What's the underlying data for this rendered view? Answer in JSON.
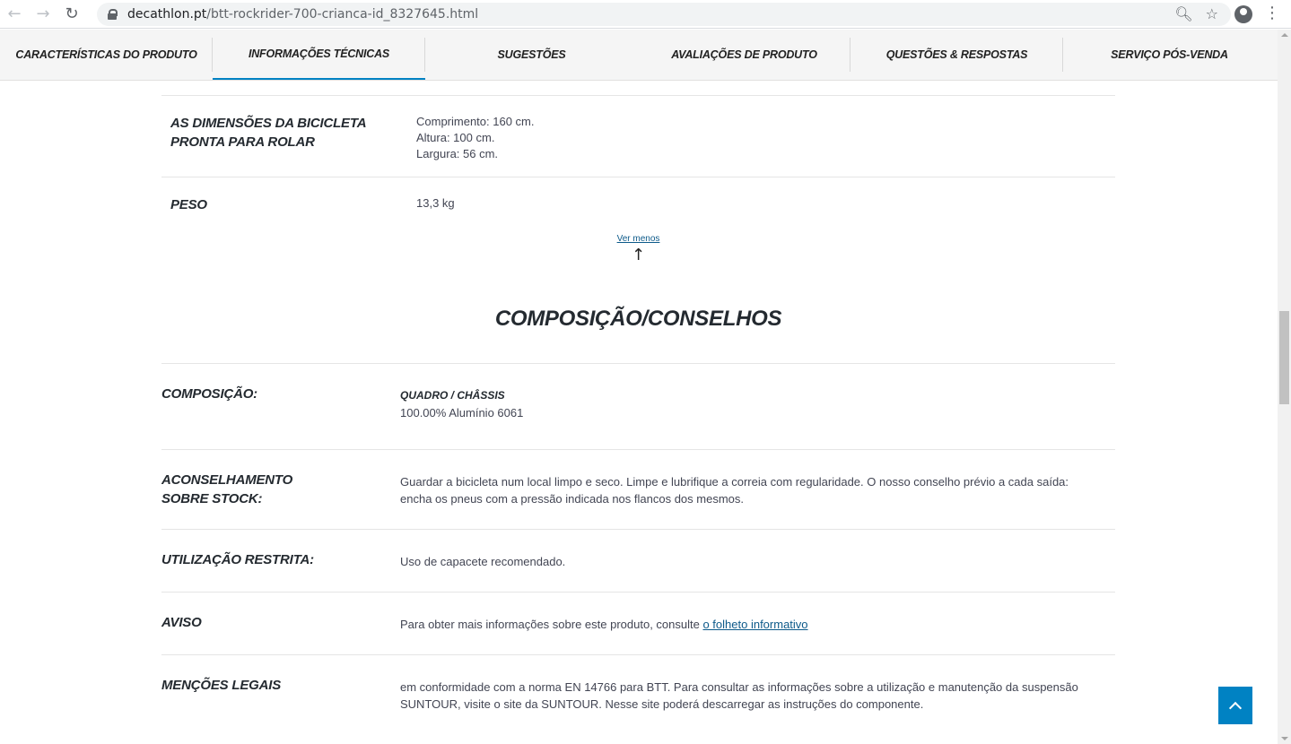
{
  "browser": {
    "url_domain": "decathlon.pt",
    "url_path": "/btt-rockrider-700-crianca-id_8327645.html"
  },
  "tabs": [
    {
      "label": "CARACTERÍSTICAS DO PRODUTO"
    },
    {
      "label": "INFORMAÇÕES TÉCNICAS"
    },
    {
      "label": "SUGESTÕES"
    },
    {
      "label": "AVALIAÇÕES DE PRODUTO"
    },
    {
      "label": "QUESTÕES & RESPOSTAS"
    },
    {
      "label": "SERVIÇO PÓS-VENDA"
    }
  ],
  "specs": {
    "dimensions": {
      "label": "AS DIMENSÕES DA BICICLETA PRONTA PARA ROLAR",
      "lines": [
        "Comprimento: 160 cm.",
        "Altura: 100 cm.",
        "Largura: 56 cm."
      ]
    },
    "weight": {
      "label": "PESO",
      "value": "13,3 kg"
    },
    "ver_menos": "Ver menos"
  },
  "composition_section": {
    "title": "COMPOSIÇÃO/CONSELHOS",
    "rows": [
      {
        "label": "COMPOSIÇÃO:",
        "sub": "QUADRO / CHÂSSIS",
        "value": "100.00% Alumínio 6061"
      },
      {
        "label": "ACONSELHAMENTO SOBRE STOCK:",
        "value": "Guardar a bicicleta num local limpo e seco. Limpe e lubrifique a correia com regularidade. O nosso conselho prévio a cada saída: encha os pneus com a pressão indicada nos flancos dos mesmos."
      },
      {
        "label": "UTILIZAÇÃO RESTRITA:",
        "value": "Uso de capacete recomendado."
      },
      {
        "label": "AVISO",
        "value": "Para obter mais informações sobre este produto, consulte ",
        "link": "o folheto informativo"
      },
      {
        "label": "MENÇÕES LEGAIS",
        "value": "em conformidade com a norma EN 14766 para BTT. Para consultar as informações sobre a utilização e manutenção da suspensão SUNTOUR, visite o site da SUNTOUR. Nesse site poderá descarregar as instruções do componente."
      }
    ]
  },
  "colors": {
    "accent": "#0082c3",
    "link": "#0d5a8a"
  }
}
